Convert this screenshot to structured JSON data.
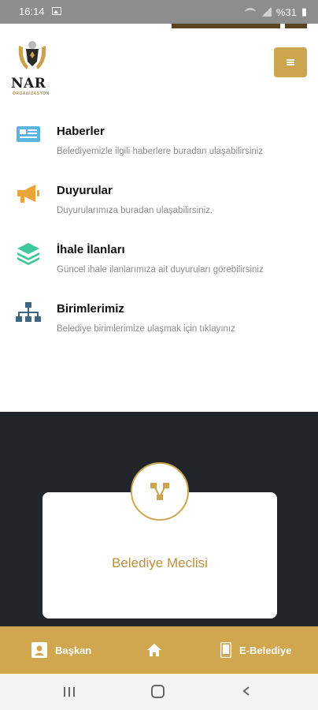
{
  "status_bar": {
    "time": "16:14",
    "battery": "%31"
  },
  "header": {
    "logo_text": "NAR",
    "logo_subtitle": "ORGANİZASYON",
    "menu_icon": "hamburger-icon"
  },
  "menu_items": [
    {
      "title": "Haberler",
      "desc": "Belediyemizle ilgili haberlere buradan ulaşabilirsiniz",
      "icon": "news-icon",
      "color": "#5bb5df"
    },
    {
      "title": "Duyurular",
      "desc": "Duyurularımıza buradan ulaşabilirsiniz.",
      "icon": "megaphone-icon",
      "color": "#e7a53a"
    },
    {
      "title": "İhale İlanları",
      "desc": "Güncel ihale ilanlarımıza ait duyuruları görebilirsiniz",
      "icon": "layers-icon",
      "color": "#3ec79a"
    },
    {
      "title": "Birimlerimiz",
      "desc": "Belediye birimlerimize ulaşmak için tıklayınız",
      "icon": "hierarchy-icon",
      "color": "#3f6680"
    }
  ],
  "feature_card": {
    "label": "Belediye Meclisi",
    "icon": "network-icon"
  },
  "bottom_nav": {
    "left_label": "Başkan",
    "center_icon": "home-icon",
    "right_label": "E-Belediye"
  },
  "colors": {
    "accent": "#cda54f",
    "dark": "#22252a"
  }
}
